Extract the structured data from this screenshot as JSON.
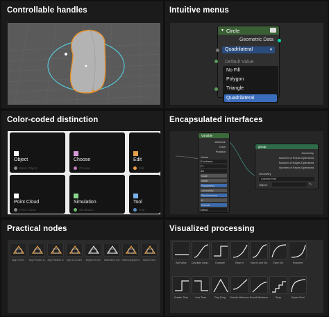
{
  "sections": {
    "handles": {
      "title": "Controllable handles"
    },
    "menus": {
      "title": "Intuitive menus"
    },
    "color": {
      "title": "Color-coded distinction"
    },
    "encapsulated": {
      "title": "Encapsulated interfaces"
    },
    "practical": {
      "title": "Practical nodes"
    },
    "visualized": {
      "title": "Visualized processing"
    }
  },
  "menu": {
    "node_title": "Circle",
    "geometric_data_label": "Geometric Data",
    "selected_value": "Quadrilateral",
    "default_value_label": "Default Value",
    "options": [
      "No Fill",
      "Polygon",
      "Triangle",
      "Quadrilateral"
    ],
    "highlighted_index": 3
  },
  "color_tiles": [
    {
      "label": "Object",
      "sub": "Basic Object",
      "swatch": "#ffffff",
      "dot": "#888888"
    },
    {
      "label": "Choose",
      "sub": "Choose",
      "swatch": "#d89ad8",
      "dot": "#c07ac0"
    },
    {
      "label": "Edit",
      "sub": "Edit",
      "swatch": "#e8a048",
      "dot": "#e8a048"
    },
    {
      "label": "Point Cloud",
      "sub": "Point Cloud",
      "swatch": "#ffffff",
      "dot": "#888888"
    },
    {
      "label": "Simulation",
      "sub": "Simulation",
      "swatch": "#8ad88a",
      "dot": "#6ab86a"
    },
    {
      "label": "Tool",
      "sub": "Tool",
      "swatch": "#7ab0e8",
      "dot": "#5a90c8"
    }
  ],
  "encap": {
    "left_node": {
      "title": "Variable",
      "outputs": [
        "Distance",
        "Color",
        "Position"
      ],
      "input": "Vector",
      "rows": [
        "Euclidean",
        "F1",
        "4D",
        "Scale",
        "Detail",
        "Roughness",
        "Lacunarity",
        "Randomness",
        "W",
        "Smooth",
        "Offset",
        "Roughness"
      ],
      "bottom": [
        "Exponent"
      ]
    },
    "right_node": {
      "title": "group",
      "header_label": "Geometry",
      "outputs": [
        "Geometry",
        "Number of Points Optimized",
        "Number of Edges Optimized",
        "Number of Faces Optimized"
      ],
      "input": "Geometry",
      "dropdown": "Convex Hull",
      "object_label": "Object:"
    }
  },
  "practical_nodes": [
    "Align Center",
    "Align Position to",
    "Align Relative to",
    "Align to Ground",
    "Alignment Grid",
    "Distribution Tool",
    "Normal Alignment",
    "Scale to Size"
  ],
  "visual_items": [
    {
      "label": "Add Value",
      "curve": "flat"
    },
    {
      "label": "Calculate Lamp...",
      "curve": "ramp"
    },
    {
      "label": "Compare",
      "curve": "step"
    },
    {
      "label": "Ease In",
      "curve": "easein"
    },
    {
      "label": "Ease In and Out",
      "curve": "smooth"
    },
    {
      "label": "Ease Out",
      "curve": "easeout"
    },
    {
      "label": "Exponent",
      "curve": "exp"
    },
    {
      "label": "Fract",
      "curve": "saw"
    },
    {
      "label": "Greater Than",
      "curve": "step"
    },
    {
      "label": "Less Than",
      "curve": "stepdown"
    },
    {
      "label": "Ping Pong",
      "curve": "tri"
    },
    {
      "label": "Smooth Maximum",
      "curve": "smoothmax"
    },
    {
      "label": "Smooth Minimum",
      "curve": "smoothmin"
    },
    {
      "label": "Snap",
      "curve": "stairs"
    },
    {
      "label": "Square Root",
      "curve": "sqrt"
    },
    {
      "label": "Subtract",
      "curve": "line"
    }
  ]
}
